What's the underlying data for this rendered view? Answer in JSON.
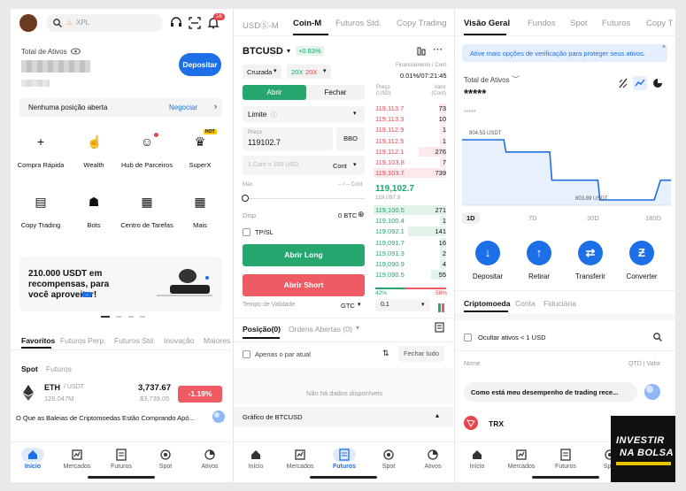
{
  "home": {
    "search_placeholder": "XPL",
    "notif_count": "16",
    "total_label": "Total de Ativos",
    "deposit_button": "Depositar",
    "no_position": "Nenhuma posição aberta",
    "negociar": "Negociar",
    "shortcuts": [
      {
        "label": "Compra Rápida",
        "icon": "plus-icon"
      },
      {
        "label": "Wealth",
        "icon": "wealth-icon"
      },
      {
        "label": "Hub de Parceiros",
        "icon": "partner-hub-icon"
      },
      {
        "label": "SuperX",
        "icon": "trophy-icon",
        "badge": "HOT"
      },
      {
        "label": "Copy Trading",
        "icon": "copy-trading-icon"
      },
      {
        "label": "Bots",
        "icon": "bots-icon"
      },
      {
        "label": "Centro de Tarefas",
        "icon": "task-center-icon"
      },
      {
        "label": "Mais",
        "icon": "grid-icon"
      }
    ],
    "promo_text": "210.000 USDT em recompensas, para você aproveitar!",
    "tabs": [
      "Favoritos",
      "Futuros Perp.",
      "Futuros Std.",
      "Inovação",
      "Maiores ..."
    ],
    "subtabs": [
      "Spot",
      "Futuros"
    ],
    "asset": {
      "symbol": "ETH",
      "quote": "/ USDT",
      "volume": "126.047M",
      "price": "3,737.67",
      "price_alt": "$3,739.05",
      "change": "-1.19%"
    },
    "news": "O Que as Baleias de Criptomoedas Estão Comprando Apó..."
  },
  "nav": {
    "items": [
      "Início",
      "Mercados",
      "Futuros",
      "Spot",
      "Ativos"
    ]
  },
  "futures": {
    "top_tabs": [
      "USDⓈ-M",
      "Coin-M",
      "Futuros Std.",
      "Copy Trading"
    ],
    "pair": "BTCUSD",
    "pair_change": "+0.83%",
    "mode": "Cruzada",
    "leverage_a": "20X",
    "leverage_b": "20X",
    "funding_label": "Financiamento / Cont.",
    "funding_value": "0.01%/07:21:45",
    "open_tab": "Abrir",
    "close_tab": "Fechar",
    "order_type": "Limite",
    "price_label": "Preço",
    "price_value": "119102.7",
    "bbo": "BBO",
    "qty_placeholder": "1 Cont = 100 USD",
    "qty_unit": "Cont",
    "max_label": "Máx",
    "max_value": "-- / -- Cont",
    "disp_label": "Disp.",
    "disp_value": "0 BTC",
    "tpsl": "TP/SL",
    "long_button": "Abrir Long",
    "short_button": "Abrir Short",
    "validity_label": "Tempo de Validade",
    "validity_value": "GTC",
    "ob_price_head": "Preço (USD)",
    "ob_value_head": "Valor (Cont)",
    "asks": [
      [
        "119,113.7",
        "73"
      ],
      [
        "119,113.3",
        "10"
      ],
      [
        "119,112.9",
        "1"
      ],
      [
        "119,112.5",
        "1"
      ],
      [
        "119,112.1",
        "276"
      ],
      [
        "119,103.8",
        "7"
      ],
      [
        "119,103.7",
        "739"
      ]
    ],
    "mid_price": "119,102.7",
    "mid_sub": "119,097.8",
    "bids": [
      [
        "119,100.5",
        "271"
      ],
      [
        "119,100.4",
        "1"
      ],
      [
        "119,092.1",
        "141"
      ],
      [
        "119,091.7",
        "16"
      ],
      [
        "119,091.3",
        "2"
      ],
      [
        "119,090.9",
        "4"
      ],
      [
        "119,090.5",
        "55"
      ]
    ],
    "ratio_buy": "42%",
    "ratio_sell": "58%",
    "depth": "0.1",
    "pos_tab": "Posição(0)",
    "orders_tab": "Ordens Abertas (0)",
    "only_pair": "Apenas o par atual",
    "close_all": "Fechar tudo",
    "no_data": "Não há dados disponíveis",
    "chart_bar": "Gráfico de BTCUSD"
  },
  "assets": {
    "top_tabs": [
      "Visão Geral",
      "Fundos",
      "Spot",
      "Futuros",
      "Copy T"
    ],
    "banner": "Ative mais opções de verificação para proteger seus ativos.",
    "total_label": "Total de Ativos",
    "total_value": "*****",
    "sub_value": "*****",
    "chart_high": "804.53 USDT",
    "chart_low": "803.89 USDT",
    "ranges": [
      "1D",
      "7D",
      "30D",
      "180D"
    ],
    "actions": [
      {
        "label": "Depositar",
        "icon": "arrow-down-icon"
      },
      {
        "label": "Retirar",
        "icon": "arrow-up-icon"
      },
      {
        "label": "Transferir",
        "icon": "transfer-icon"
      },
      {
        "label": "Converter",
        "icon": "convert-icon"
      }
    ],
    "subtabs": [
      "Criptomoeda",
      "Conta",
      "Fiduciária"
    ],
    "hide_small": "Ocultar ativos < 1 USD",
    "col_name": "Nome",
    "col_qty": "QTD | Valor",
    "chat_prompt": "Como está meu desempenho de trading rece...",
    "coin": "TRX",
    "watermark_line1": "INVESTIR",
    "watermark_line2": "NA BOLSA"
  },
  "colors": {
    "accent": "#1c6fe6",
    "long": "#27a770",
    "short": "#ef5b63"
  },
  "chart_data": {
    "type": "line",
    "x": [
      "1D"
    ],
    "values_usdt": [
      804.53,
      804.53,
      804.4,
      804.4,
      804.1,
      804.1,
      803.89,
      803.89,
      804.1
    ],
    "ylim": [
      803.89,
      804.53
    ]
  }
}
